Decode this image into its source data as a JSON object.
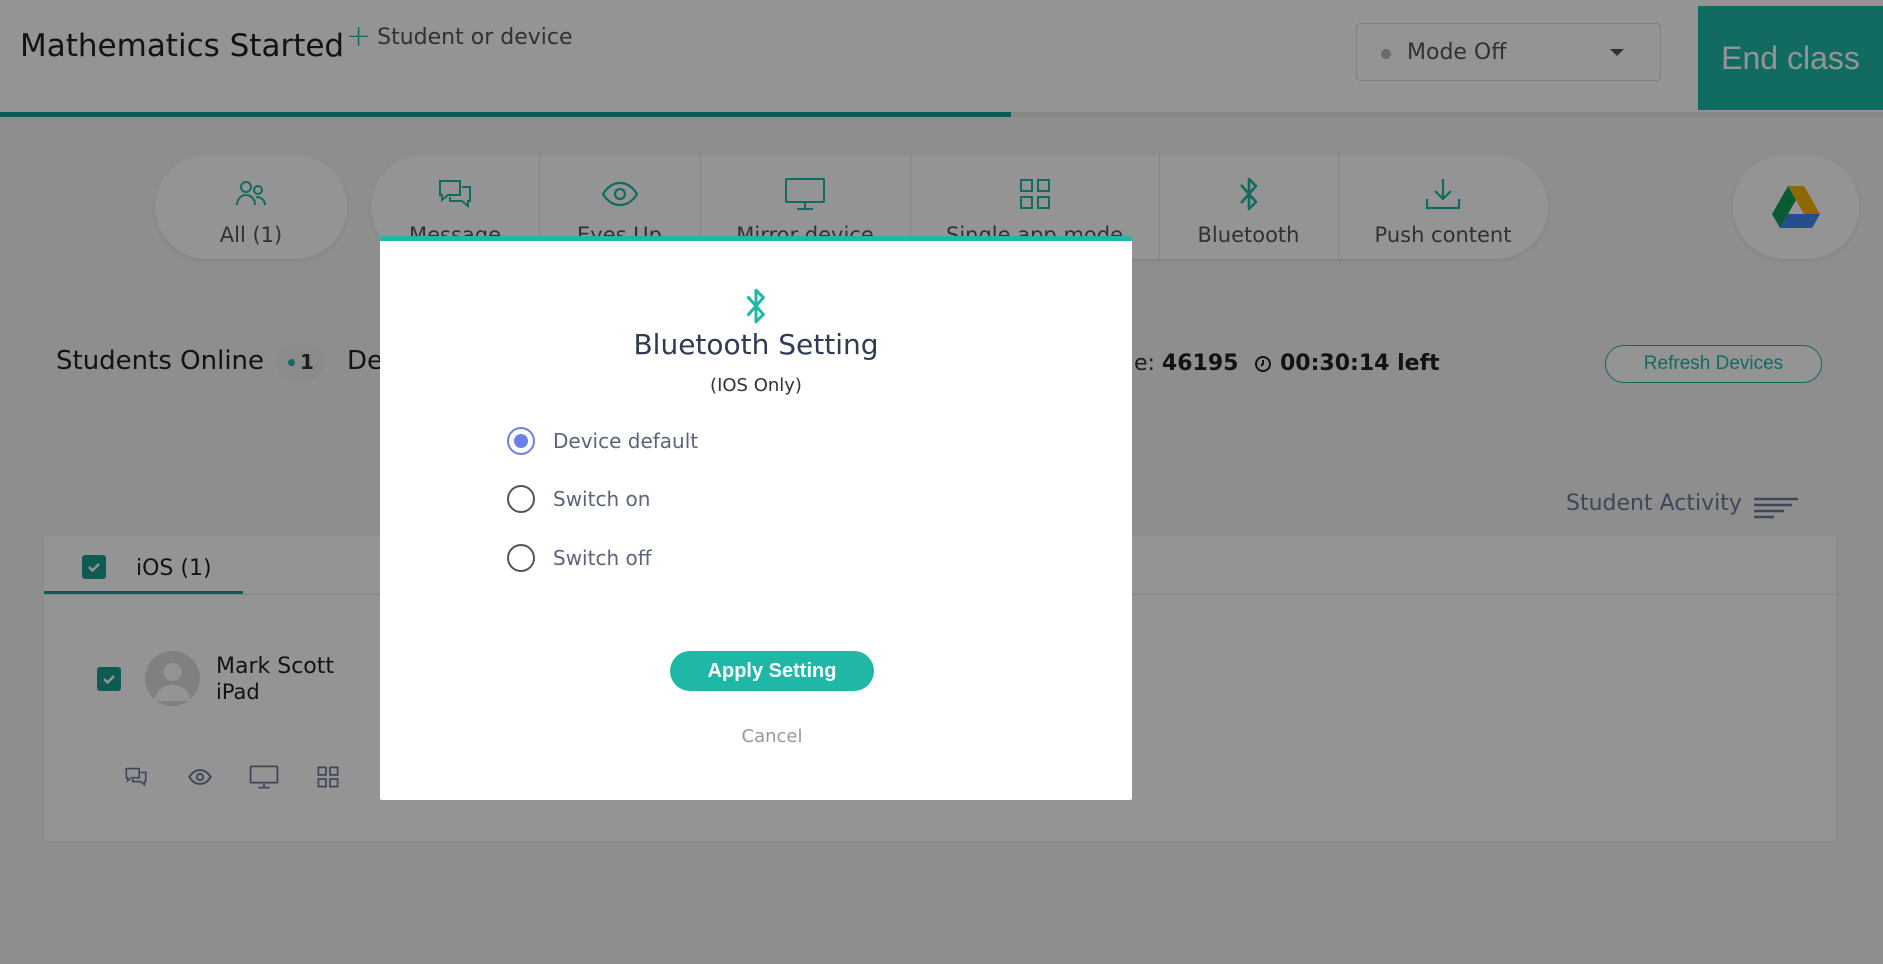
{
  "header": {
    "class_title": "Mathematics Started",
    "add_label": "Student or device",
    "mode_label": "Mode Off",
    "end_class": "End class",
    "class_progress": 0.537
  },
  "toolbar": {
    "all_label": "All (1)",
    "items": [
      {
        "label": "Message",
        "icon": "message-icon"
      },
      {
        "label": "Eyes Up",
        "icon": "eye-icon"
      },
      {
        "label": "Mirror device",
        "icon": "monitor-icon"
      },
      {
        "label": "Single app mode",
        "icon": "grid-icon"
      },
      {
        "label": "Bluetooth",
        "icon": "bluetooth-icon"
      },
      {
        "label": "Push content",
        "icon": "download-icon"
      }
    ],
    "drive_icon": "google-drive-icon"
  },
  "status": {
    "students_online": "Students Online",
    "online_count": "1",
    "de_text": "De",
    "code_prefix": "de:",
    "code_value": "46195",
    "time_left": "00:30:14 left",
    "refresh": "Refresh Devices"
  },
  "activity": {
    "label": "Student Activity"
  },
  "device_list": {
    "tab_label": "iOS (1)",
    "student_name": "Mark Scott",
    "student_device": "iPad"
  },
  "modal": {
    "title": "Bluetooth Setting",
    "subtitle": "(IOS Only)",
    "options": [
      {
        "label": "Device default",
        "selected": true
      },
      {
        "label": "Switch on",
        "selected": false
      },
      {
        "label": "Switch off",
        "selected": false
      }
    ],
    "apply": "Apply Setting",
    "cancel": "Cancel"
  },
  "colors": {
    "accent": "#1fb8a6",
    "accent_dark": "#1a9d8f",
    "radio_selected": "#6b7fe6",
    "overlay": "rgba(0,0,0,0.42)"
  }
}
